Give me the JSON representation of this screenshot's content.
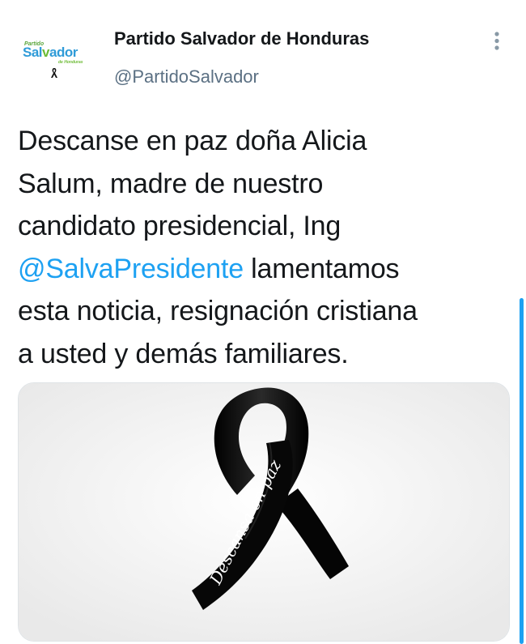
{
  "author": {
    "display_name": "Partido Salvador de Honduras",
    "handle": "@PartidoSalvador",
    "avatar_logo": {
      "small_text": "Partido",
      "main_text_start": "Sal",
      "main_text_v": "v",
      "main_text_end": "ador",
      "sub_text": "de Honduras"
    }
  },
  "tweet": {
    "line1": "Descanse en paz doña Alicia",
    "line2": "Salum, madre de nuestro",
    "line3": "candidato presidencial, Ing",
    "mention": "@SalvaPresidente",
    "line4_rest": " lamentamos",
    "line5": "esta noticia, resignación cristiana",
    "line6": "a usted y demás familiares."
  },
  "media": {
    "ribbon_text": "Descansa en paz"
  },
  "icons": {
    "more": "more-vertical-icon",
    "ribbon": "mourning-ribbon-icon"
  },
  "colors": {
    "link": "#1da1f2",
    "secondary_text": "#5b7083",
    "ribbon": "#0a0a0a"
  }
}
